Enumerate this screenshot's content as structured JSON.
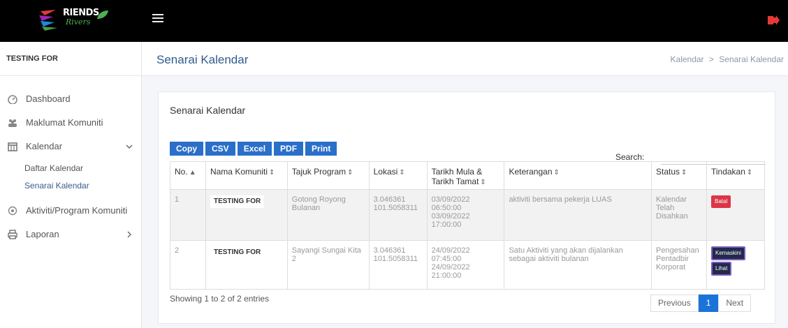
{
  "brand": {
    "name_top": "RIENDS",
    "name_sub": "Rivers"
  },
  "icons": {
    "menu": "hamburger-icon",
    "logout": "sign-out-icon"
  },
  "colors": {
    "primary": "#2a6fc9",
    "danger": "#dc3545",
    "logout": "#e53935"
  },
  "sidebar": {
    "header": "TESTING FOR",
    "items": [
      {
        "label": "Dashboard",
        "icon": "dashboard-icon"
      },
      {
        "label": "Maklumat Komuniti",
        "icon": "users-icon"
      },
      {
        "label": "Kalendar",
        "icon": "calendar-icon"
      },
      {
        "label": "Aktiviti/Program Komuniti",
        "icon": "activity-icon"
      },
      {
        "label": "Laporan",
        "icon": "print-icon"
      }
    ],
    "sub_items": [
      {
        "label": "Daftar Kalendar"
      },
      {
        "label": "Senarai Kalendar"
      }
    ]
  },
  "header": {
    "title": "Senarai Kalendar",
    "breadcrumb": {
      "parent": "Kalendar",
      "separator": ">",
      "current": "Senarai Kalendar"
    }
  },
  "card": {
    "title": "Senarai Kalendar",
    "buttons": [
      "Copy",
      "CSV",
      "Excel",
      "PDF",
      "Print"
    ],
    "search_label": "Search:",
    "search_value": ""
  },
  "table": {
    "columns": [
      {
        "label": "No.",
        "sort": "▲"
      },
      {
        "label": "Nama Komuniti",
        "sort": "⇕"
      },
      {
        "label": "Tajuk Program",
        "sort": "⇕"
      },
      {
        "label": "Lokasi",
        "sort": "⇕"
      },
      {
        "label": "Tarikh Mula & Tarikh Tamat",
        "sort": "⇕"
      },
      {
        "label": "Keterangan",
        "sort": "⇕"
      },
      {
        "label": "Status",
        "sort": "⇕"
      },
      {
        "label": "Tindakan",
        "sort": "⇕"
      }
    ],
    "rows": [
      {
        "no": "1",
        "komuniti": "TESTING FOR",
        "program": "Gotong Royong Bulanan",
        "lokasi": "3.046361 101.5058311",
        "tarikh": "03/09/2022 06:50:00 03/09/2022 17:00:00",
        "keterangan": "aktiviti bersama pekerja LUAS",
        "status": "Kalendar Telah Disahkan",
        "actions": [
          "Batal"
        ]
      },
      {
        "no": "2",
        "komuniti": "TESTING FOR",
        "program": "Sayangi Sungai Kita 2",
        "lokasi": "3.046361 101.5058311",
        "tarikh": "24/09/2022 07:45:00 24/09/2022 21:00:00",
        "keterangan": "Satu Aktiviti yang akan dijalankan sebagai aktiviti bulanan",
        "status": "Pengesahan Pentadbir Korporat",
        "actions": [
          "Kemaskini",
          "Lihat"
        ]
      }
    ]
  },
  "footer": {
    "info": "Showing 1 to 2 of 2 entries",
    "pager": {
      "prev": "Previous",
      "current": "1",
      "next": "Next"
    }
  }
}
